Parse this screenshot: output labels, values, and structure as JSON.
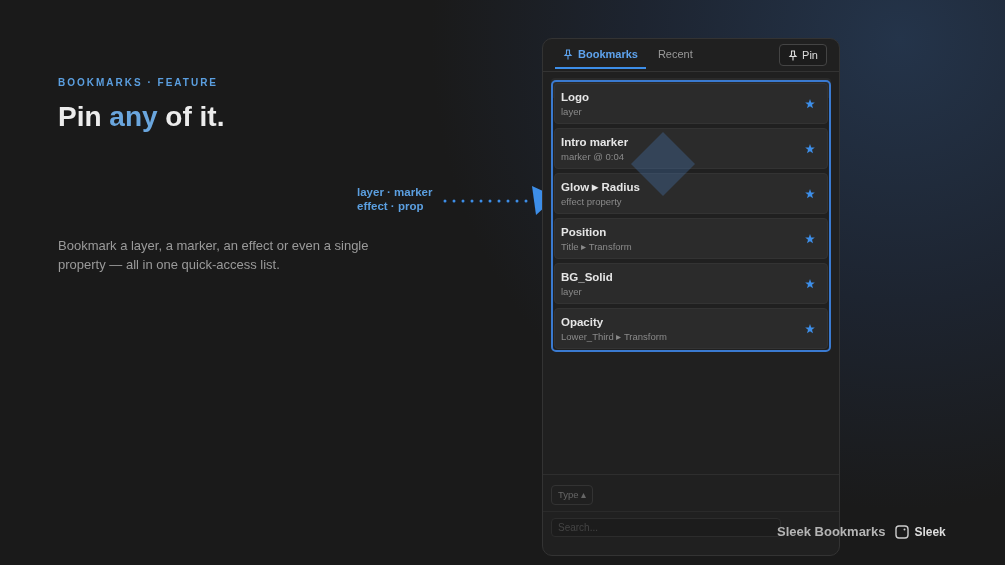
{
  "eyebrow": "BOOKMARKS · FEATURE",
  "headline": {
    "before": "Pin ",
    "highlight": "any",
    "after": " of it."
  },
  "description": "Bookmark a layer, a marker, an effect or even a single property — all in one quick-access list.",
  "callout": {
    "lines": [
      "layer · marker",
      "effect · prop"
    ]
  },
  "panel": {
    "tabs": [
      {
        "label": "Bookmarks",
        "selected": true
      },
      {
        "label": "Recent",
        "selected": false
      }
    ],
    "pin_button": "Pin",
    "bookmarks": [
      {
        "title": "Logo",
        "subtitle": "layer",
        "starred": true
      },
      {
        "title": "Intro marker",
        "subtitle": "marker @ 0:04",
        "starred": true
      },
      {
        "title": "Glow ▸ Radius",
        "subtitle": "effect property",
        "starred": true
      },
      {
        "title": "Position",
        "subtitle": "Title ▸ Transform",
        "starred": true
      },
      {
        "title": "BG_Solid",
        "subtitle": "layer",
        "starred": true
      },
      {
        "title": "Opacity",
        "subtitle": "Lower_Third ▸ Transform",
        "starred": true
      }
    ],
    "type_filter": "Type ▴",
    "search": {
      "placeholder": "Search..."
    }
  },
  "footer": {
    "product": "Sleek Bookmarks",
    "brand": "Sleek"
  }
}
